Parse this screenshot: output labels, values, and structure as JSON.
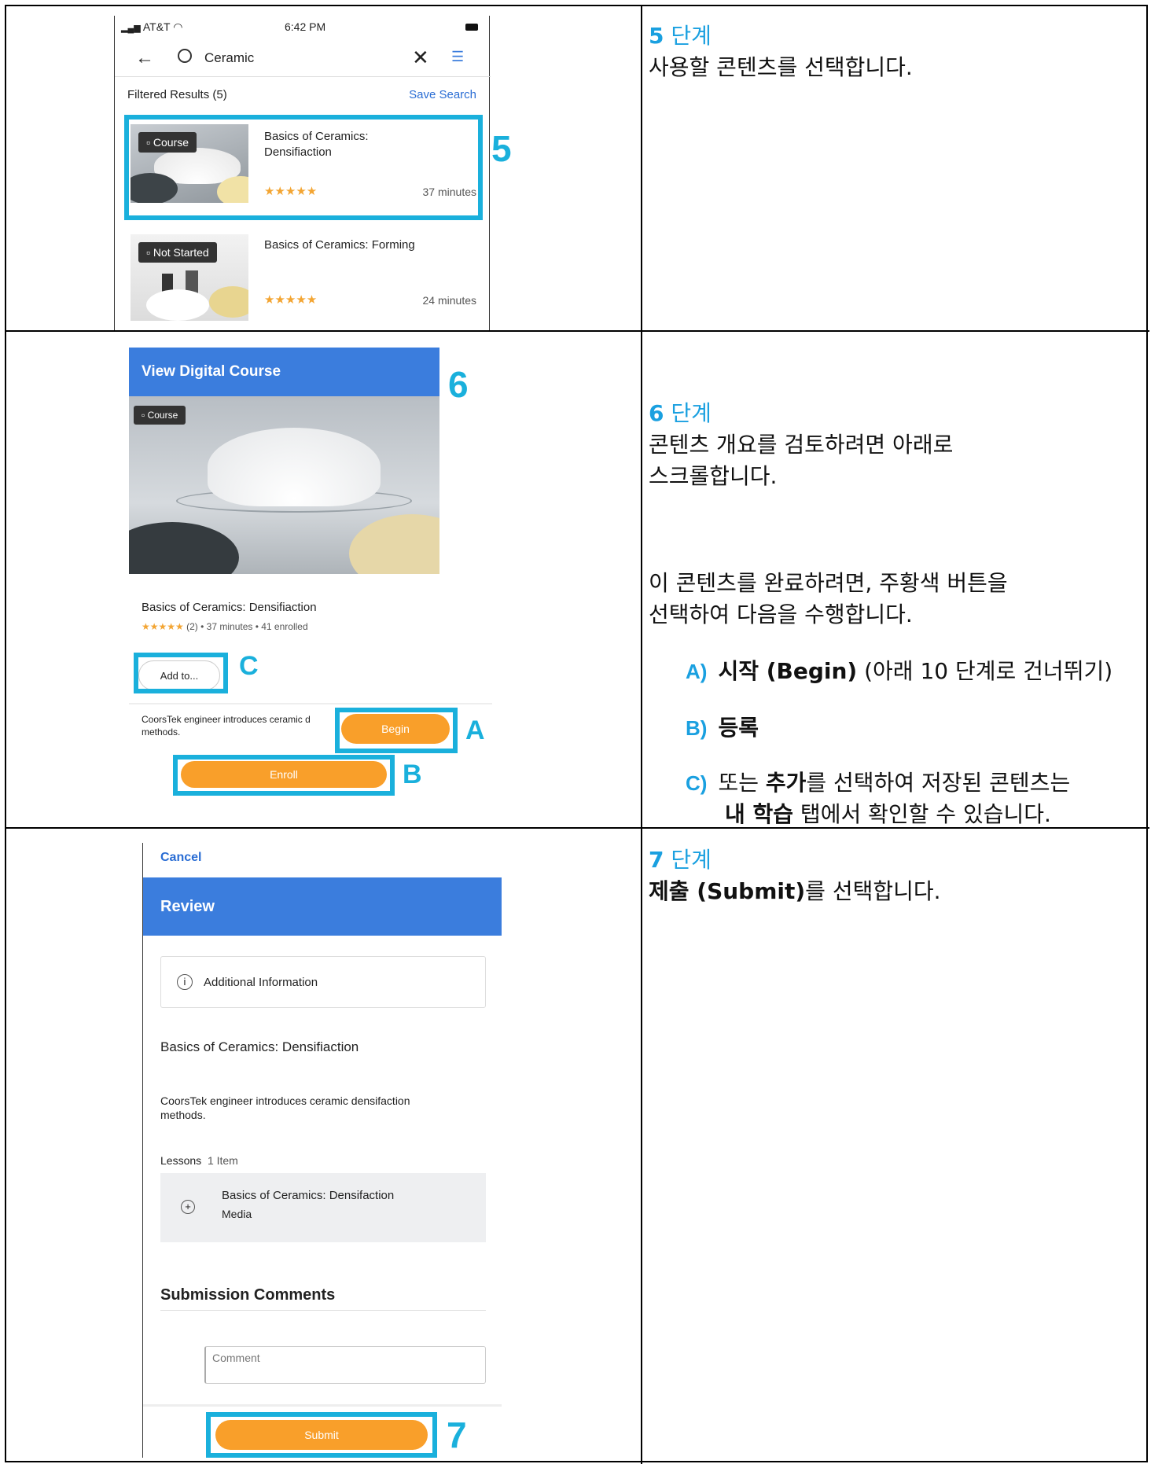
{
  "s5": {
    "status": {
      "carrier": "AT&T",
      "time": "6:42 PM"
    },
    "search_text": "Ceramic",
    "filtered": "Filtered Results (5)",
    "save_search": "Save Search",
    "card1": {
      "badge": "Course",
      "title": "Basics of Ceramics: Densifiaction",
      "duration": "37 minutes"
    },
    "card2": {
      "badge": "Not Started",
      "title": "Basics of Ceramics: Forming",
      "duration": "24 minutes"
    },
    "marker": "5",
    "step_num": "5",
    "step_word": "단계",
    "desc": "사용할 콘텐츠를 선택합니다."
  },
  "s6": {
    "header": "View Digital Course",
    "badge": "Course",
    "title": "Basics of Ceramics: Densifiaction",
    "meta": "(2)  •  37 minutes  •  41 enrolled",
    "add_to": "Add to...",
    "desc_line1": "CoorsTek engineer introduces ceramic d",
    "desc_line2": "methods.",
    "begin": "Begin",
    "enroll": "Enroll",
    "marker": "6",
    "marker_a": "A",
    "marker_b": "B",
    "marker_c": "C",
    "step_num": "6",
    "step_word": "단계",
    "desc1": "콘텐츠 개요를 검토하려면 아래로",
    "desc2": "스크롤합니다.",
    "desc3": "이 콘텐츠를 완료하려면, 주황색 버튼을",
    "desc4": "선택하여 다음을 수행합니다.",
    "optA_label": "A)",
    "optA_bold": "시작 (Begin)",
    "optA_rest": " (아래 10 단계로 건너뛰기)",
    "optB_label": "B)",
    "optB_bold": "등록",
    "optC_label": "C)",
    "optC_pre": "또는 ",
    "optC_bold": "추가",
    "optC_rest": "를 선택하여 저장된 콘텐츠는",
    "optC_bold2": "내 학습",
    "optC_rest2": " 탭에서 확인할 수 있습니다."
  },
  "s7": {
    "cancel": "Cancel",
    "header": "Review",
    "additional": "Additional Information",
    "title": "Basics of Ceramics: Densifiaction",
    "desc1": "CoorsTek engineer introduces ceramic densifaction",
    "desc2": "methods.",
    "lessons_label": "Lessons",
    "lessons_count": "1 Item",
    "lesson_title": "Basics of Ceramics: Densifaction",
    "lesson_type": "Media",
    "comments_title": "Submission Comments",
    "comment_placeholder": "Comment",
    "submit": "Submit",
    "marker": "7",
    "step_num": "7",
    "step_word": "단계",
    "desc_bold": "제출 (Submit)",
    "desc_rest": "를 선택합니다."
  },
  "colors": {
    "accent": "#1ab0dc",
    "blue_header": "#3b7ddd",
    "orange": "#f99f2a",
    "star": "#f3a533"
  }
}
